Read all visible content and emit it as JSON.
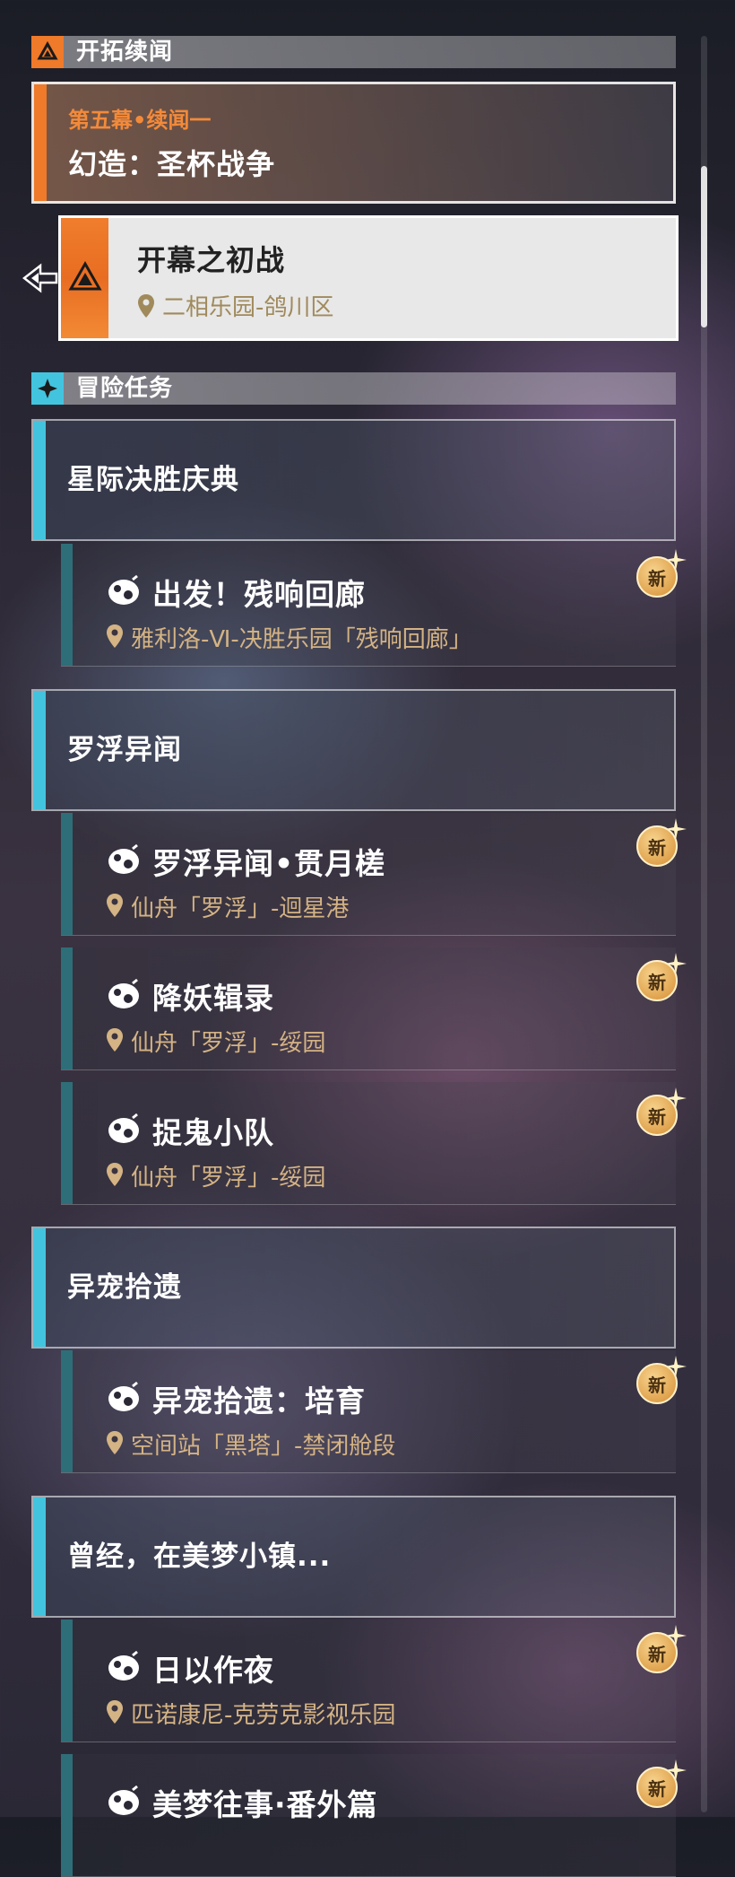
{
  "sections": {
    "trailblaze": {
      "title": "开拓续闻"
    },
    "adventure": {
      "title": "冒险任务"
    }
  },
  "story": {
    "subtitle": "第五幕•续闻一",
    "title": "幻造：圣杯战争"
  },
  "selected": {
    "title": "开幕之初战",
    "location": "二相乐园-鸽川区"
  },
  "badge_label": "新",
  "groups": [
    {
      "title": "星际决胜庆典",
      "quests": [
        {
          "title": "出发！残响回廊",
          "location": "雅利洛-Ⅵ-决胜乐园「残响回廊」",
          "new": true
        }
      ]
    },
    {
      "title": "罗浮异闻",
      "quests": [
        {
          "title": "罗浮异闻•贯月槎",
          "location": "仙舟「罗浮」-迴星港",
          "new": true
        },
        {
          "title": "降妖辑录",
          "location": "仙舟「罗浮」-绥园",
          "new": true
        },
        {
          "title": "捉鬼小队",
          "location": "仙舟「罗浮」-绥园",
          "new": true
        }
      ]
    },
    {
      "title": "异宠拾遗",
      "quests": [
        {
          "title": "异宠拾遗：培育",
          "location": "空间站「黑塔」-禁闭舱段",
          "new": true
        }
      ]
    },
    {
      "title": "曾经，在美梦小镇...",
      "quests": [
        {
          "title": "日以作夜",
          "location": "匹诺康尼-克劳克影视乐园",
          "new": true
        },
        {
          "title": "美梦往事·番外篇",
          "location": "",
          "new": true
        }
      ]
    }
  ],
  "colors": {
    "trailblaze": "#ee7a2a",
    "adventure": "#43c4de",
    "quest_bar": "#2e6e78",
    "location": "#d4b384"
  },
  "icons": [
    "trailblaze-icon",
    "adventure-icon",
    "quest-icon",
    "location-pin-icon",
    "new-badge-icon",
    "selection-pointer-icon"
  ]
}
